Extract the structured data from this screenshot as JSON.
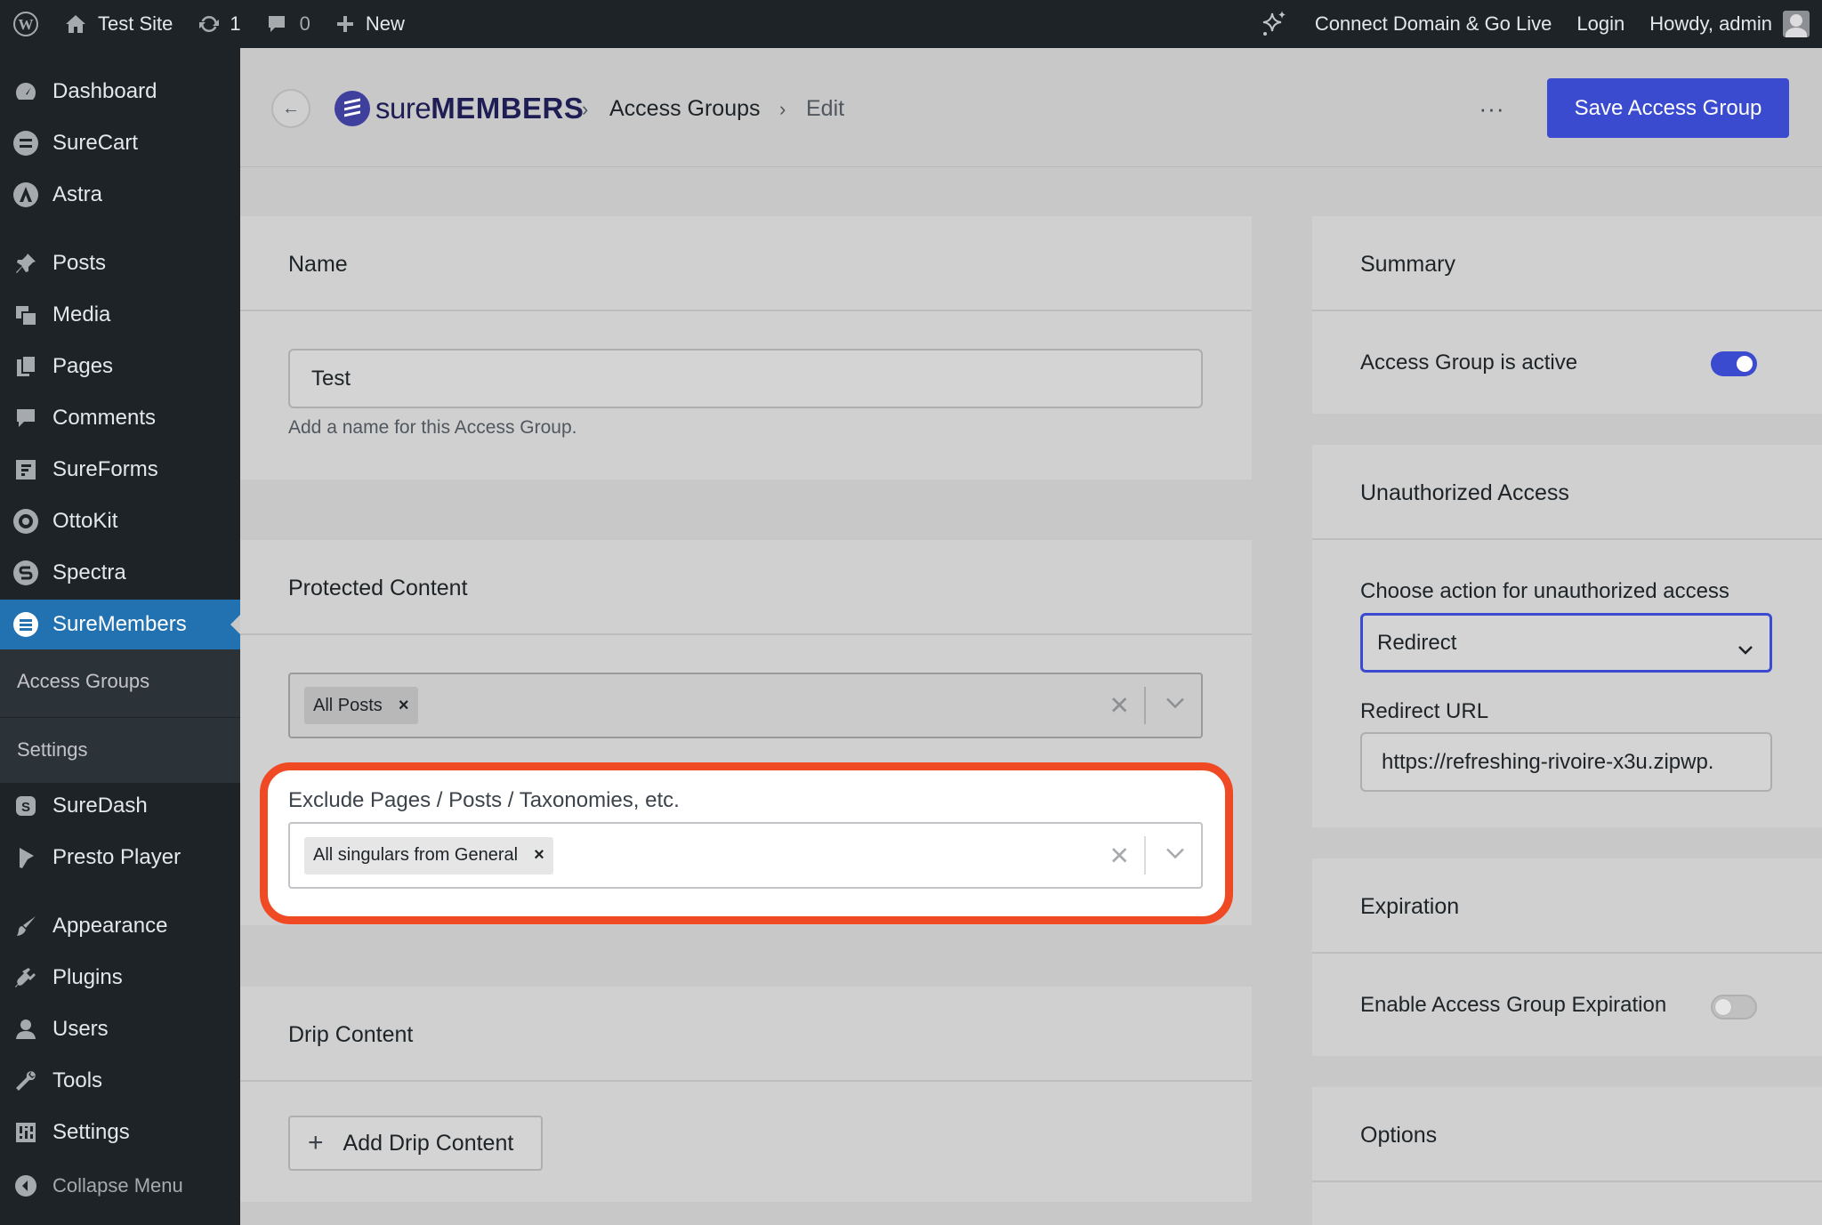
{
  "adminbar": {
    "site_name": "Test Site",
    "updates_count": "1",
    "comments_count": "0",
    "new_label": "New",
    "connect_label": "Connect Domain & Go Live",
    "login_label": "Login",
    "howdy_label": "Howdy, admin"
  },
  "sidebar": {
    "items": [
      {
        "label": "Dashboard",
        "icon": "dashboard-icon"
      },
      {
        "label": "SureCart",
        "icon": "surecart-icon"
      },
      {
        "label": "Astra",
        "icon": "astra-icon"
      },
      {
        "label": "Posts",
        "icon": "pin-icon"
      },
      {
        "label": "Media",
        "icon": "media-icon"
      },
      {
        "label": "Pages",
        "icon": "pages-icon"
      },
      {
        "label": "Comments",
        "icon": "comments-icon"
      },
      {
        "label": "SureForms",
        "icon": "sureforms-icon"
      },
      {
        "label": "OttoKit",
        "icon": "ottokit-icon"
      },
      {
        "label": "Spectra",
        "icon": "spectra-icon"
      },
      {
        "label": "SureMembers",
        "icon": "suremembers-icon"
      },
      {
        "label": "SureDash",
        "icon": "suredash-icon"
      },
      {
        "label": "Presto Player",
        "icon": "presto-icon"
      },
      {
        "label": "Appearance",
        "icon": "brush-icon"
      },
      {
        "label": "Plugins",
        "icon": "plugin-icon"
      },
      {
        "label": "Users",
        "icon": "users-icon"
      },
      {
        "label": "Tools",
        "icon": "wrench-icon"
      },
      {
        "label": "Settings",
        "icon": "settings-icon"
      }
    ],
    "submenu": [
      "Access Groups",
      "Settings"
    ],
    "collapse_label": "Collapse Menu"
  },
  "header": {
    "logo_light": "sure",
    "logo_bold": "MEMBERS",
    "crumb_1": "Access Groups",
    "crumb_2": "Edit",
    "more_label": "···",
    "save_label": "Save Access Group"
  },
  "name_card": {
    "title": "Name",
    "value": "Test",
    "help": "Add a name for this Access Group."
  },
  "protected_card": {
    "title": "Protected Content",
    "include_tag": "All Posts",
    "exclude_label": "Exclude Pages / Posts / Taxonomies, etc.",
    "exclude_tag": "All singulars from General"
  },
  "drip_card": {
    "title": "Drip Content",
    "add_label": "Add Drip Content"
  },
  "summary_card": {
    "title": "Summary",
    "active_label": "Access Group is active",
    "active": true
  },
  "unauth_card": {
    "title": "Unauthorized Access",
    "action_label": "Choose action for unauthorized access",
    "action_value": "Redirect",
    "redirect_label": "Redirect URL",
    "redirect_value": "https://refreshing-rivoire-x3u.zipwp."
  },
  "expiration_card": {
    "title": "Expiration",
    "enable_label": "Enable Access Group Expiration",
    "enabled": false
  },
  "options_card": {
    "title": "Options"
  },
  "colors": {
    "primary": "#3b4bd0",
    "highlight": "#f04a24",
    "wp_blue": "#2271b1",
    "sidebar": "#1d2327"
  }
}
